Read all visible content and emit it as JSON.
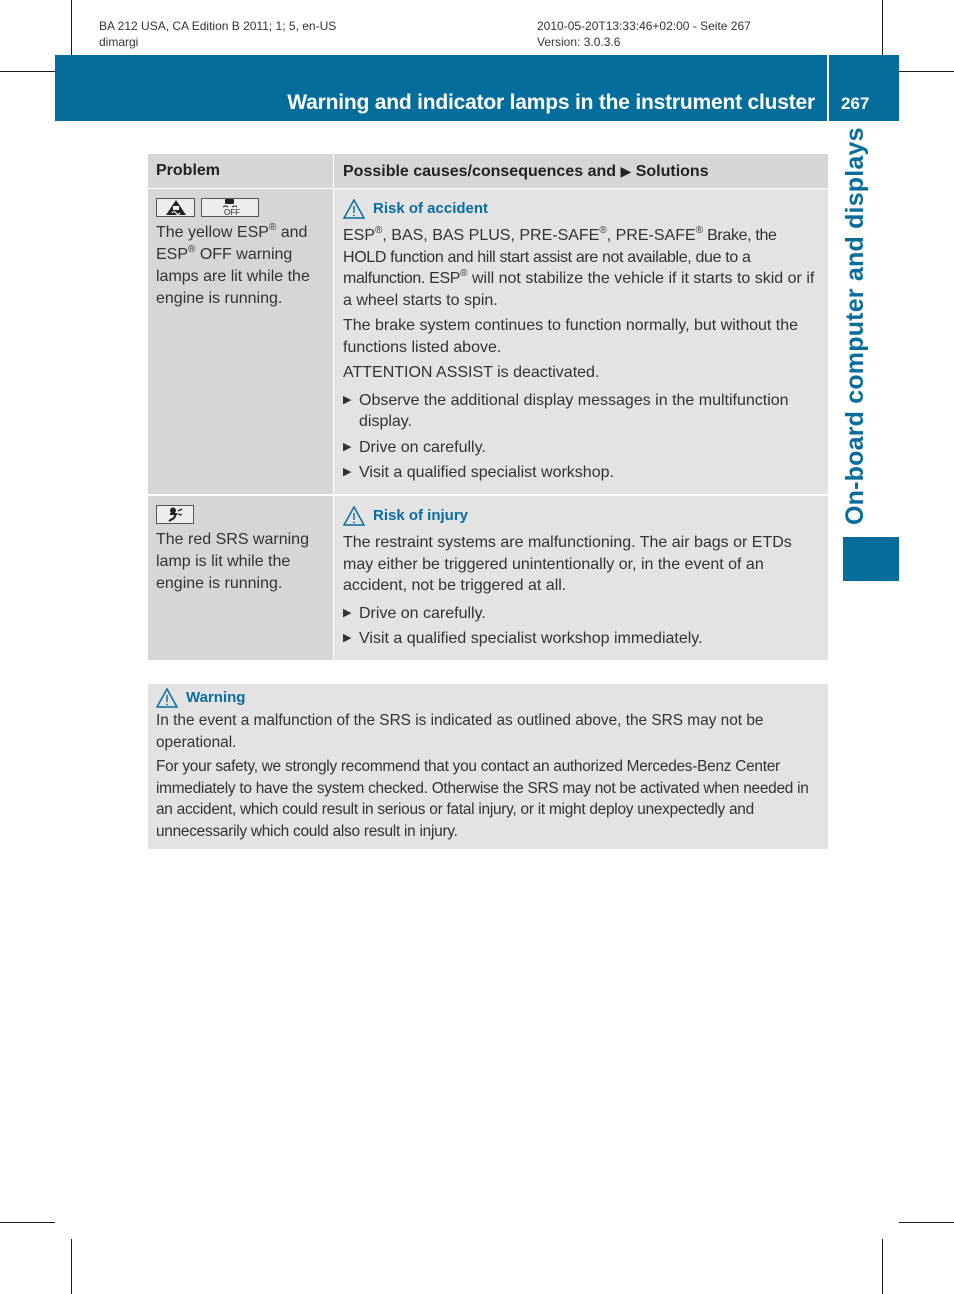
{
  "meta": {
    "left_line1": "BA 212 USA, CA Edition B 2011; 1; 5, en-US",
    "left_line2": "dimargi",
    "right_line1": "2010-05-20T13:33:46+02:00 - Seite 267",
    "right_line2": "Version: 3.0.3.6"
  },
  "header": {
    "title": "Warning and indicator lamps in the instrument cluster",
    "page_number": "267",
    "color": "#046d9c"
  },
  "side_tab": {
    "label": "On-board computer and displays"
  },
  "table": {
    "headers": {
      "problem": "Problem",
      "causes_prefix": "Possible causes/consequences and",
      "causes_arrow": "▶",
      "causes_suffix": "Solutions"
    },
    "rows": [
      {
        "icons": [
          "esp-warning-lamp-icon",
          "esp-off-lamp-icon"
        ],
        "problem": {
          "p1": "The yellow ESP",
          "sup1": "®",
          "p2": " and ESP",
          "sup2": "®",
          "p3": " OFF warning lamps are lit while the engine is running."
        },
        "risk_label": "Risk of accident",
        "para1": {
          "a": "ESP",
          "r1": "®",
          "b": ", BAS, BAS PLUS, PRE-SAFE",
          "r2": "®",
          "c": ", PRE-SAFE",
          "r3": "®",
          "d": " Brake, the HOLD function and hill start assist are not available, due to a malfunction. ESP",
          "r4": "®",
          "e": " will not stabilize the vehicle if it starts to skid or if a wheel starts to spin."
        },
        "para2": "The brake system continues to function normally, but without the functions listed above.",
        "para3": "ATTENTION ASSIST is deactivated.",
        "bullets": [
          "Observe the additional display messages in the multifunction display.",
          "Drive on carefully.",
          "Visit a qualified specialist workshop."
        ]
      },
      {
        "icons": [
          "srs-airbag-lamp-icon"
        ],
        "problem": "The red SRS warning lamp is lit while the engine is running.",
        "risk_label": "Risk of injury",
        "para1": "The restraint systems are malfunctioning. The air bags or ETDs may either be triggered unintentionally or, in the event of an accident, not be triggered at all.",
        "bullets": [
          "Drive on carefully.",
          "Visit a qualified specialist workshop immediately."
        ]
      }
    ]
  },
  "warning_box": {
    "label": "Warning",
    "para1": "In the event a malfunction of the SRS is indicated as outlined above, the SRS may not be operational.",
    "para2": "For your safety, we strongly recommend that you contact an authorized Mercedes-Benz Center immediately to have the system checked. Otherwise the SRS may not be activated when needed in an accident, which could result in serious or fatal injury, or it might deploy unexpectedly and unnecessarily which could also result in injury."
  },
  "bullet_glyph": "▶"
}
